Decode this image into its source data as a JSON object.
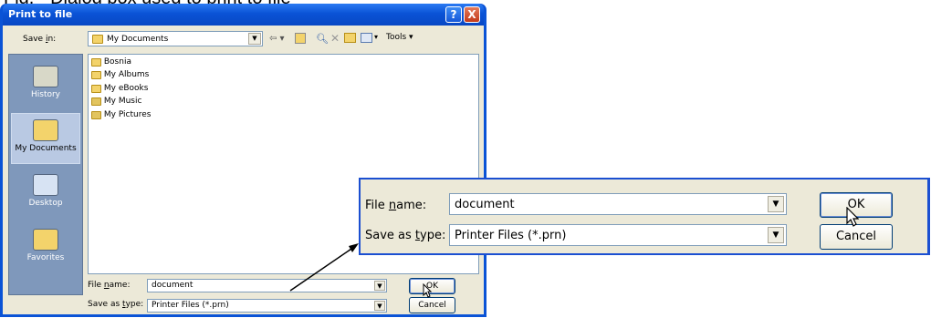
{
  "caption": "Fig. - Dialog box used to print to file",
  "dialog": {
    "title": "Print to file",
    "help_button": "?",
    "close_button": "X",
    "save_in_label": "Save in:",
    "save_in_value": "My Documents",
    "tools_label": "Tools",
    "places": [
      {
        "label": "History",
        "icon": "history-icon",
        "color": "#d8d8c8"
      },
      {
        "label": "My Documents",
        "icon": "my-documents-icon",
        "color": "#f3d36b"
      },
      {
        "label": "Desktop",
        "icon": "desktop-icon",
        "color": "#d7e3f3"
      },
      {
        "label": "Favorites",
        "icon": "favorites-icon",
        "color": "#f3d36b"
      }
    ],
    "files": [
      "Bosnia",
      "My Albums",
      "My eBooks",
      "My Music",
      "My Pictures"
    ],
    "file_name_label": "File name:",
    "file_name_value": "document",
    "save_as_type_label": "Save as type:",
    "save_as_type_value": "Printer Files (*.prn)",
    "ok_label": "OK",
    "cancel_label": "Cancel"
  },
  "zoom": {
    "file_name_label": "File name:",
    "file_name_value": "document",
    "save_as_type_label": "Save as type:",
    "save_as_type_value": "Printer Files (*.prn)",
    "ok_label": "OK",
    "cancel_label": "Cancel"
  },
  "colors": {
    "titlebar": "#0a53d6",
    "dialog_face": "#ece9d8",
    "places_bar": "#7f98bb",
    "callout_border": "#1b4fd1"
  }
}
